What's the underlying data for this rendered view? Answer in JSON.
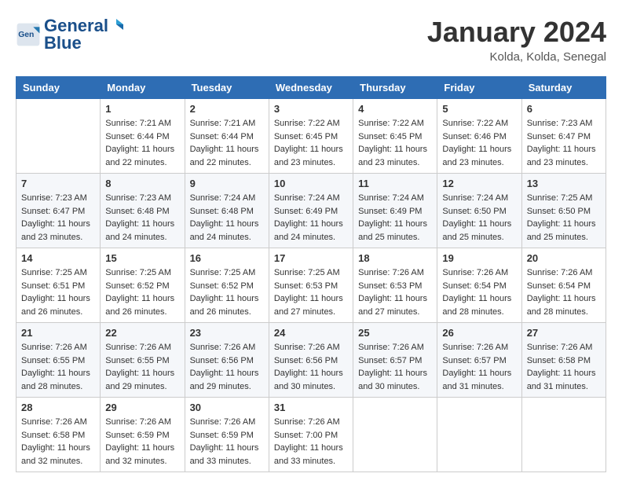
{
  "header": {
    "logo_line1": "General",
    "logo_line2": "Blue",
    "month": "January 2024",
    "location": "Kolda, Kolda, Senegal"
  },
  "days_of_week": [
    "Sunday",
    "Monday",
    "Tuesday",
    "Wednesday",
    "Thursday",
    "Friday",
    "Saturday"
  ],
  "weeks": [
    [
      {
        "day": "",
        "info": ""
      },
      {
        "day": "1",
        "info": "Sunrise: 7:21 AM\nSunset: 6:44 PM\nDaylight: 11 hours and 22 minutes."
      },
      {
        "day": "2",
        "info": "Sunrise: 7:21 AM\nSunset: 6:44 PM\nDaylight: 11 hours and 22 minutes."
      },
      {
        "day": "3",
        "info": "Sunrise: 7:22 AM\nSunset: 6:45 PM\nDaylight: 11 hours and 23 minutes."
      },
      {
        "day": "4",
        "info": "Sunrise: 7:22 AM\nSunset: 6:45 PM\nDaylight: 11 hours and 23 minutes."
      },
      {
        "day": "5",
        "info": "Sunrise: 7:22 AM\nSunset: 6:46 PM\nDaylight: 11 hours and 23 minutes."
      },
      {
        "day": "6",
        "info": "Sunrise: 7:23 AM\nSunset: 6:47 PM\nDaylight: 11 hours and 23 minutes."
      }
    ],
    [
      {
        "day": "7",
        "info": ""
      },
      {
        "day": "8",
        "info": "Sunrise: 7:23 AM\nSunset: 6:48 PM\nDaylight: 11 hours and 24 minutes."
      },
      {
        "day": "9",
        "info": "Sunrise: 7:24 AM\nSunset: 6:48 PM\nDaylight: 11 hours and 24 minutes."
      },
      {
        "day": "10",
        "info": "Sunrise: 7:24 AM\nSunset: 6:49 PM\nDaylight: 11 hours and 24 minutes."
      },
      {
        "day": "11",
        "info": "Sunrise: 7:24 AM\nSunset: 6:49 PM\nDaylight: 11 hours and 25 minutes."
      },
      {
        "day": "12",
        "info": "Sunrise: 7:24 AM\nSunset: 6:50 PM\nDaylight: 11 hours and 25 minutes."
      },
      {
        "day": "13",
        "info": "Sunrise: 7:25 AM\nSunset: 6:50 PM\nDaylight: 11 hours and 25 minutes."
      }
    ],
    [
      {
        "day": "14",
        "info": ""
      },
      {
        "day": "15",
        "info": "Sunrise: 7:25 AM\nSunset: 6:52 PM\nDaylight: 11 hours and 26 minutes."
      },
      {
        "day": "16",
        "info": "Sunrise: 7:25 AM\nSunset: 6:52 PM\nDaylight: 11 hours and 26 minutes."
      },
      {
        "day": "17",
        "info": "Sunrise: 7:25 AM\nSunset: 6:53 PM\nDaylight: 11 hours and 27 minutes."
      },
      {
        "day": "18",
        "info": "Sunrise: 7:26 AM\nSunset: 6:53 PM\nDaylight: 11 hours and 27 minutes."
      },
      {
        "day": "19",
        "info": "Sunrise: 7:26 AM\nSunset: 6:54 PM\nDaylight: 11 hours and 28 minutes."
      },
      {
        "day": "20",
        "info": "Sunrise: 7:26 AM\nSunset: 6:54 PM\nDaylight: 11 hours and 28 minutes."
      }
    ],
    [
      {
        "day": "21",
        "info": ""
      },
      {
        "day": "22",
        "info": "Sunrise: 7:26 AM\nSunset: 6:55 PM\nDaylight: 11 hours and 29 minutes."
      },
      {
        "day": "23",
        "info": "Sunrise: 7:26 AM\nSunset: 6:56 PM\nDaylight: 11 hours and 29 minutes."
      },
      {
        "day": "24",
        "info": "Sunrise: 7:26 AM\nSunset: 6:56 PM\nDaylight: 11 hours and 30 minutes."
      },
      {
        "day": "25",
        "info": "Sunrise: 7:26 AM\nSunset: 6:57 PM\nDaylight: 11 hours and 30 minutes."
      },
      {
        "day": "26",
        "info": "Sunrise: 7:26 AM\nSunset: 6:57 PM\nDaylight: 11 hours and 31 minutes."
      },
      {
        "day": "27",
        "info": "Sunrise: 7:26 AM\nSunset: 6:58 PM\nDaylight: 11 hours and 31 minutes."
      }
    ],
    [
      {
        "day": "28",
        "info": ""
      },
      {
        "day": "29",
        "info": "Sunrise: 7:26 AM\nSunset: 6:59 PM\nDaylight: 11 hours and 32 minutes."
      },
      {
        "day": "30",
        "info": "Sunrise: 7:26 AM\nSunset: 6:59 PM\nDaylight: 11 hours and 33 minutes."
      },
      {
        "day": "31",
        "info": "Sunrise: 7:26 AM\nSunset: 7:00 PM\nDaylight: 11 hours and 33 minutes."
      },
      {
        "day": "",
        "info": ""
      },
      {
        "day": "",
        "info": ""
      },
      {
        "day": "",
        "info": ""
      }
    ]
  ],
  "week1_sunday_info": "Sunrise: 7:23 AM\nSunset: 6:47 PM\nDaylight: 11 hours and 23 minutes.",
  "week2_sunday_info": "Sunrise: 7:23 AM\nSunset: 6:47 PM\nDaylight: 11 hours and 23 minutes.",
  "week3_sunday_info": "Sunrise: 7:25 AM\nSunset: 6:51 PM\nDaylight: 11 hours and 26 minutes.",
  "week4_sunday_info": "Sunrise: 7:26 AM\nSunset: 6:55 PM\nDaylight: 11 hours and 28 minutes.",
  "week5_sunday_info": "Sunrise: 7:26 AM\nSunset: 6:58 PM\nDaylight: 11 hours and 32 minutes."
}
